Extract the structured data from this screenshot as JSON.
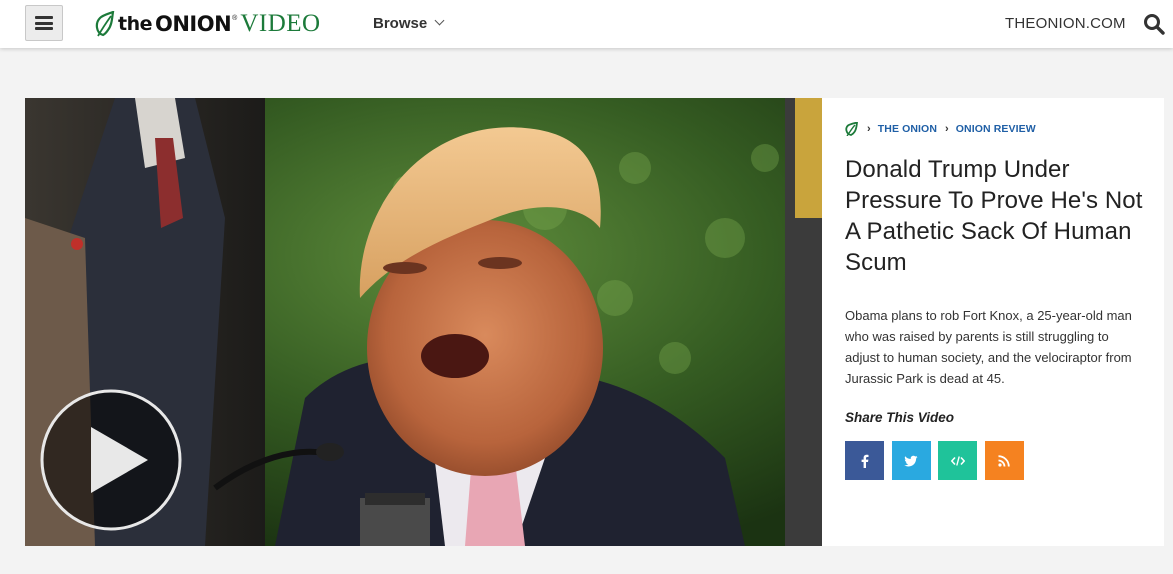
{
  "header": {
    "logo_the": "the",
    "logo_onion": "ONION",
    "logo_registered": "®",
    "logo_video": "VIDEO",
    "browse_label": "Browse",
    "site_link": "THEONION.COM"
  },
  "breadcrumb": {
    "items": [
      "THE ONION",
      "ONION REVIEW"
    ]
  },
  "video": {
    "title": "Donald Trump Under Pressure To Prove He's Not A Pathetic Sack Of Human Scum",
    "description": "Obama plans to rob Fort Knox, a 25-year-old man who was raised by parents is still struggling to adjust to human society, and the velociraptor from Jurassic Park is dead at 45."
  },
  "share": {
    "label": "Share This Video",
    "buttons": [
      {
        "name": "facebook",
        "icon": "facebook-icon",
        "color": "#3b5998"
      },
      {
        "name": "twitter",
        "icon": "twitter-icon",
        "color": "#2aa9e0"
      },
      {
        "name": "embed",
        "icon": "code-icon",
        "color": "#1fc39a"
      },
      {
        "name": "rss",
        "icon": "rss-icon",
        "color": "#f58220"
      }
    ]
  },
  "colors": {
    "brand_green": "#1c7a3a",
    "link_blue": "#1f5fa6",
    "page_bg": "#f3f3f3"
  }
}
